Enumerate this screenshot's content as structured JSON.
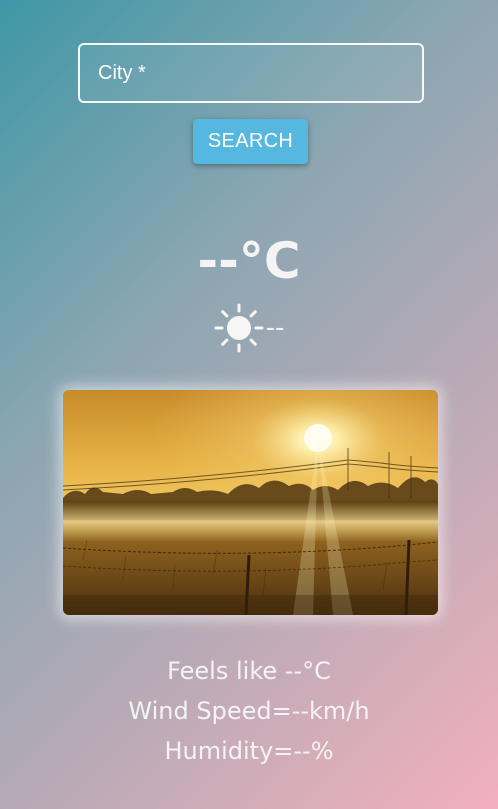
{
  "search": {
    "placeholder": "City *",
    "value": "",
    "button_label": "SEARCH"
  },
  "weather": {
    "temperature": "--°C",
    "condition": "--",
    "condition_icon": "sun-icon",
    "image_icon": "sunny-field-photo"
  },
  "details": {
    "feels_like": "Feels like --°C",
    "wind_speed": "Wind Speed=--km/h",
    "humidity": "Humidity=--%"
  },
  "colors": {
    "gradient_start": "#3f97a6",
    "gradient_end": "#f2b0bc",
    "button": "#56b7e0",
    "text": "#f4f4f4"
  }
}
